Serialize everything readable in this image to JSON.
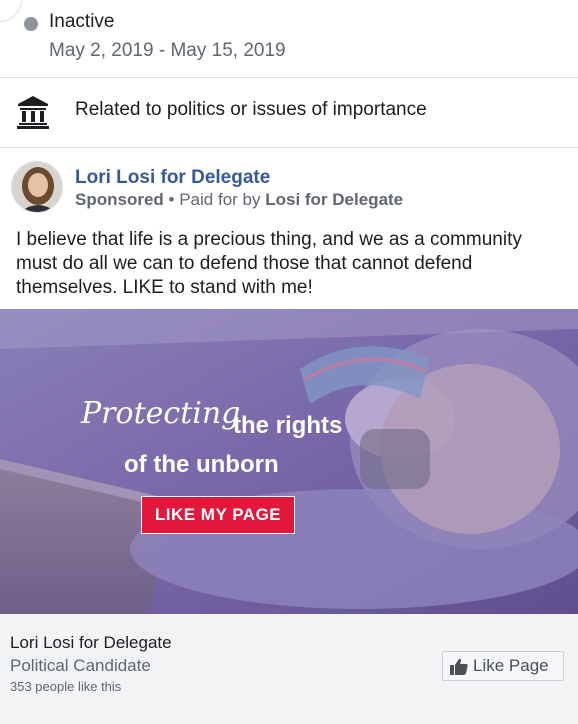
{
  "status": {
    "label": "Inactive",
    "date_range": "May 2, 2019 - May 15, 2019"
  },
  "category": {
    "icon": "bank-icon",
    "label": "Related to politics or issues of importance"
  },
  "ad": {
    "page_name": "Lori Losi for Delegate",
    "sponsored": "Sponsored",
    "separator": "•",
    "paid_for_prefix": "Paid for by",
    "paid_for_by": "Losi for Delegate",
    "body_text": "I believe that life is a precious thing, and we as a community must do all we can to defend those that cannot defend themselves. LIKE to stand with me!",
    "image": {
      "headline_script": "Protecting",
      "headline_rest": "the rights",
      "headline_line2": "of the unborn",
      "cta_label": "LIKE MY PAGE"
    }
  },
  "footer": {
    "page_name": "Lori Losi for Delegate",
    "category": "Political Candidate",
    "likes": "353 people like this",
    "like_button_label": "Like Page"
  },
  "colors": {
    "link": "#385898",
    "cta_red": "#e3173b",
    "overlay": "#7b6aa8"
  }
}
